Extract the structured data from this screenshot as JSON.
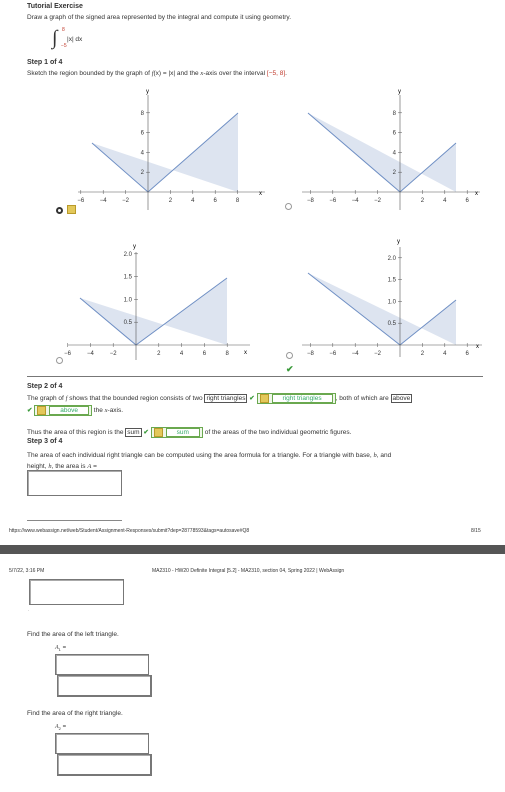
{
  "header": {
    "title": "Tutorial Exercise",
    "instruction": "Draw a graph of the signed area represented by the integral and compute it using geometry."
  },
  "integral": {
    "upper": "8",
    "lower": "−5",
    "integrand": "|x| dx"
  },
  "step1": {
    "label": "Step 1 of 4",
    "text_a": "Sketch the region bounded by the graph of ",
    "fx": "f",
    "text_b": "(x) = |x| and the ",
    "xaxis": "x",
    "text_c": "-axis over the interval ",
    "interval": "[−5, 8]",
    "period": "."
  },
  "graphs": {
    "axis_x": "x",
    "axis_y": "y",
    "g1": {
      "xticks": [
        "−6",
        "−4",
        "−2",
        "2",
        "4",
        "6",
        "8"
      ],
      "yticks": [
        "2",
        "4",
        "6",
        "8"
      ]
    },
    "g2": {
      "xticks": [
        "−8",
        "−6",
        "−4",
        "−2",
        "2",
        "4",
        "6"
      ],
      "yticks": [
        "2",
        "4",
        "6",
        "8"
      ]
    },
    "g3": {
      "xticks": [
        "−6",
        "−4",
        "−2",
        "2",
        "4",
        "6",
        "8"
      ],
      "yticks": [
        "0.5",
        "1.0",
        "1.5",
        "2.0"
      ]
    },
    "g4": {
      "xticks": [
        "−8",
        "−6",
        "−4",
        "−2",
        "2",
        "4",
        "6"
      ],
      "yticks": [
        "0.5",
        "1.0",
        "1.5",
        "2.0"
      ]
    }
  },
  "step2": {
    "label": "Step 2 of 4",
    "text_a": "The graph of ",
    "f": "f",
    "text_b": " shows that the bounded region consists of two ",
    "answer1": "right triangles",
    "answer1_shown": "right triangles",
    "text_c": ", both of which are ",
    "answer2": "above",
    "answer2_shown": "above",
    "text_d": " the ",
    "xaxis": "x",
    "text_e": "-axis."
  },
  "area_line": {
    "text_a": "Thus the area of this region is the ",
    "answer": "sum",
    "answer_shown": "sum",
    "text_b": " of the areas of the two individual geometric figures."
  },
  "step3": {
    "label": "Step 3 of 4",
    "text_a": "The area of each individual right triangle can be computed using the area formula for a triangle. For a triangle with base, ",
    "b": "b",
    "text_b": ", and",
    "text_c": "height, ",
    "h": "h",
    "text_d": ", the area is ",
    "A": "A",
    "text_e": " ="
  },
  "footer1": {
    "url": "https://www.webassign.net/web/Student/Assignment-Responses/submit?dep=28778593&tags=autosave#Q8",
    "page": "8/15"
  },
  "header2": {
    "datetime": "5/7/22, 3:16 PM",
    "title": "MA2310 - HW20 Definite Integral [5.2] - MA2310, section 04, Spring 2022 | WebAssign"
  },
  "left_triangle": {
    "prompt": "Find the area of the left triangle.",
    "var": "A",
    "sub": "1",
    "eq": " ="
  },
  "right_triangle": {
    "prompt": "Find the area of the right triangle.",
    "var": "A",
    "sub": "2",
    "eq": " ="
  },
  "colors": {
    "fill": "#dde4f0",
    "line": "#6f8fc4",
    "check": "#3a9a3a",
    "answer_border": "#6aa84f"
  }
}
